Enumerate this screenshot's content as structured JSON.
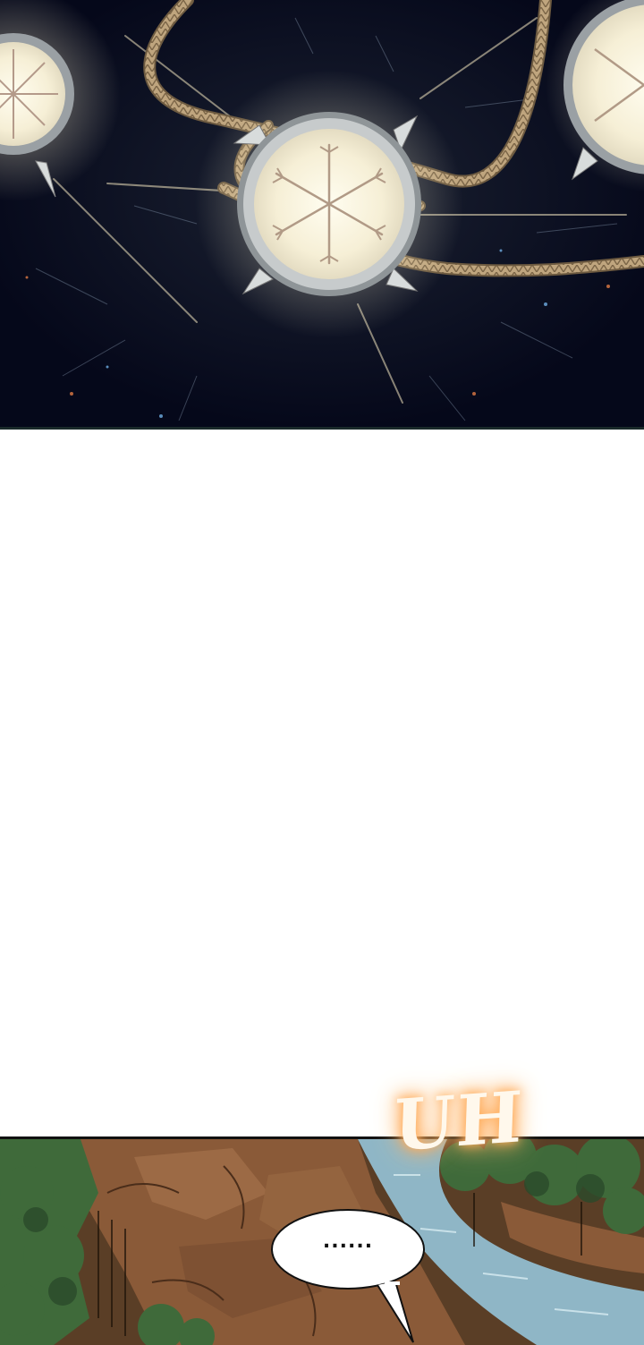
{
  "panels": {
    "top": {
      "scene": "medallions-on-rope",
      "colors": {
        "sky": "#06091a",
        "glow": "#fff6da",
        "rope": "#c9b28a",
        "spike": "#d8dcdc"
      }
    },
    "middle": {
      "colors": {
        "background": "#ffffff"
      }
    },
    "bottom": {
      "colors": {
        "rock": "#8a5a38",
        "forest": "#3f6a3a",
        "water": "#8fb6c6"
      }
    }
  },
  "sfx": {
    "text": "UH"
  },
  "speech_bubble": {
    "text": "......"
  }
}
